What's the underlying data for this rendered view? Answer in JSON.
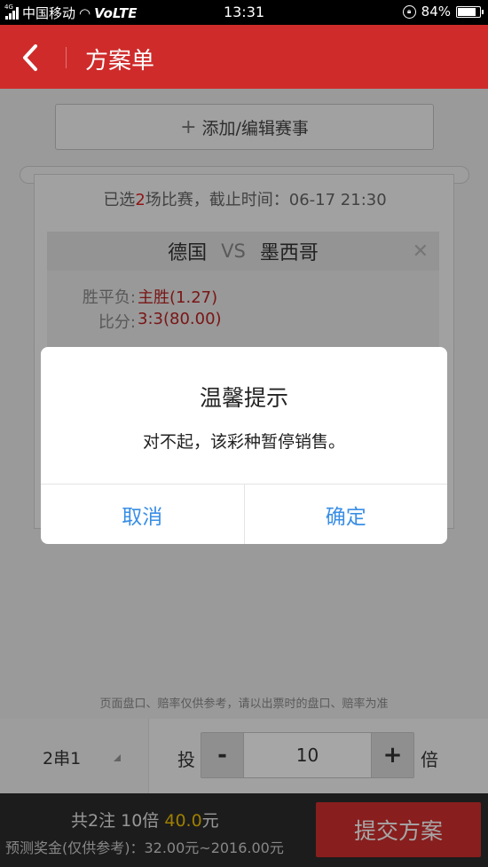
{
  "status_bar": {
    "network_tag": "4G",
    "carrier": "中国移动",
    "volte": "VoLTE",
    "time": "13:31",
    "battery": "84%",
    "battery_level": 0.84
  },
  "header": {
    "title": "方案单"
  },
  "add_button": {
    "label": "添加/编辑赛事"
  },
  "ticket": {
    "summary_prefix": "已选",
    "match_count": "2",
    "summary_suffix": "场比赛，截止时间：06-17 21:30",
    "match": {
      "home": "德国",
      "vs": "VS",
      "away": "墨西哥",
      "bets": [
        {
          "label": "胜平负:",
          "value": "主胜(1.27)"
        },
        {
          "label": "比分:",
          "value": "3:3(80.00)"
        }
      ]
    }
  },
  "dialog": {
    "title": "温馨提示",
    "message": "对不起，该彩种暂停销售。",
    "cancel": "取消",
    "confirm": "确定"
  },
  "disclaimer": "页面盘口、赔率仅供参考，请以出票时的盘口、赔率为准",
  "bet_panel": {
    "mode": "2串1",
    "tou_label": "投",
    "minus": "-",
    "multiplier": "10",
    "plus": "+",
    "bei_label": "倍"
  },
  "footer": {
    "summary_prefix": "共2注 10倍 ",
    "amount": "40.0",
    "unit": "元",
    "prize": "预测奖金(仅供参考)：32.00元~2016.00元",
    "submit": "提交方案"
  },
  "colors": {
    "brand_red": "#cf2b2b",
    "dialog_button_blue": "#3a8ee6",
    "amount_yellow": "#f2c200"
  }
}
